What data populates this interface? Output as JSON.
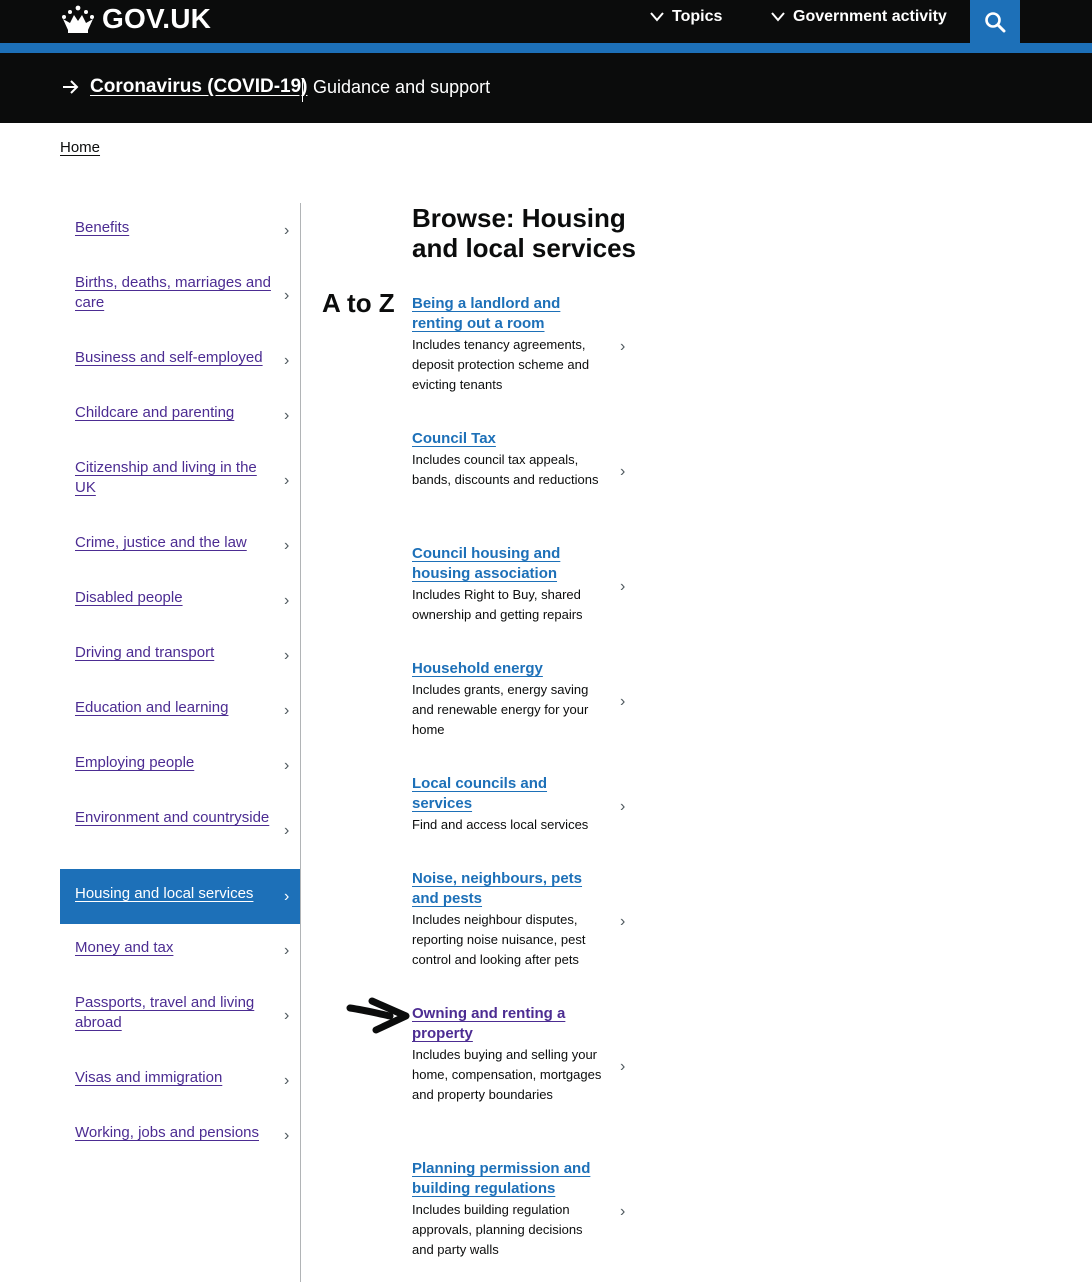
{
  "header": {
    "logo_text": "GOV.UK",
    "nav": {
      "topics": "Topics",
      "government_activity": "Government activity"
    },
    "colors": {
      "header_bg": "#0b0c0c",
      "accent": "#1d70b8"
    }
  },
  "covid_banner": {
    "link": "Coronavirus (COVID-19)",
    "text": "Guidance and support"
  },
  "breadcrumb": {
    "home": "Home"
  },
  "sidebar": {
    "items": [
      {
        "label": "Benefits"
      },
      {
        "label": "Births, deaths, marriages and care"
      },
      {
        "label": "Business and self-employed"
      },
      {
        "label": "Childcare and parenting"
      },
      {
        "label": "Citizenship and living in the UK"
      },
      {
        "label": "Crime, justice and the law"
      },
      {
        "label": "Disabled people"
      },
      {
        "label": "Driving and transport"
      },
      {
        "label": "Education and learning"
      },
      {
        "label": "Employing people"
      },
      {
        "label": "Environment and countryside"
      },
      {
        "label": "Housing and local services"
      },
      {
        "label": "Money and tax"
      },
      {
        "label": "Passports, travel and living abroad"
      },
      {
        "label": "Visas and immigration"
      },
      {
        "label": "Working, jobs and pensions"
      }
    ],
    "active_item": "Housing and local services"
  },
  "main": {
    "title": "Browse: Housing and local services",
    "a_to_z": "A to Z",
    "topics": [
      {
        "title": "Being a landlord and renting out a room",
        "description": "Includes tenancy agreements, deposit protection scheme and evicting tenants"
      },
      {
        "title": "Council Tax",
        "description": "Includes council tax appeals, bands, discounts and reductions"
      },
      {
        "title": "Council housing and housing association",
        "description": "Includes Right to Buy, shared ownership and getting repairs"
      },
      {
        "title": "Household energy",
        "description": "Includes grants, energy saving and renewable energy for your home"
      },
      {
        "title": "Local councils and services",
        "description": "Find and access local services"
      },
      {
        "title": "Noise, neighbours, pets and pests",
        "description": "Includes neighbour disputes, reporting noise nuisance, pest control and looking after pets"
      },
      {
        "title": "Owning and renting a property",
        "description": "Includes buying and selling your home, compensation, mortgages and property boundaries"
      },
      {
        "title": "Planning permission and building regulations",
        "description": "Includes building regulation approvals, planning decisions and party walls"
      }
    ],
    "highlighted_topic": "Owning and renting a property"
  },
  "icons": {
    "logo": "crown-icon",
    "nav_chevron": "chevron-down-icon",
    "search": "search-icon",
    "covid_arrow": "arrow-right-icon",
    "list_chevron": "chevron-right-icon",
    "annotation": "hand-drawn-arrow-icon"
  }
}
